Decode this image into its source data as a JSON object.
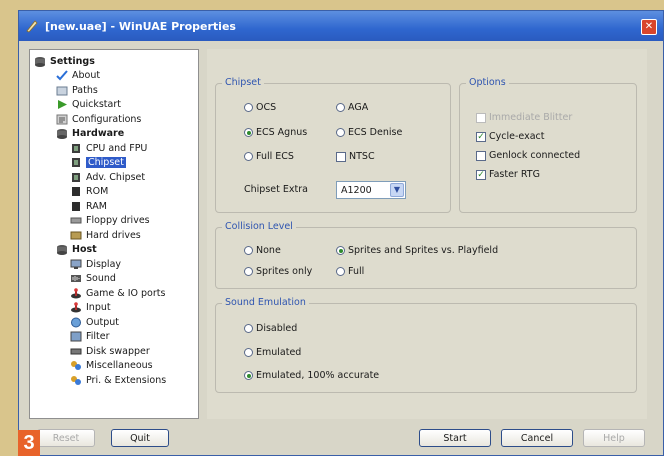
{
  "window": {
    "title": "[new.uae] - WinUAE Properties",
    "close_glyph": "✕"
  },
  "tree": {
    "settings_label": "Settings",
    "about": "About",
    "paths": "Paths",
    "quickstart": "Quickstart",
    "configurations": "Configurations",
    "hardware_label": "Hardware",
    "hardware_items": [
      "CPU and FPU",
      "Chipset",
      "Adv. Chipset",
      "ROM",
      "RAM",
      "Floppy drives",
      "Hard drives"
    ],
    "host_label": "Host",
    "host_items": [
      "Display",
      "Sound",
      "Game & IO ports",
      "Input",
      "Output",
      "Filter",
      "Disk swapper",
      "Miscellaneous",
      "Pri. & Extensions"
    ],
    "selected": "Chipset"
  },
  "chipset": {
    "legend": "Chipset",
    "ocs": "OCS",
    "aga": "AGA",
    "ecs_agnus": "ECS Agnus",
    "ecs_denise": "ECS Denise",
    "full_ecs": "Full ECS",
    "ntsc": "NTSC",
    "extra_label": "Chipset Extra",
    "extra_value": "A1200"
  },
  "options": {
    "legend": "Options",
    "immediate_blitter": "Immediate Blitter",
    "cycle_exact": "Cycle-exact",
    "genlock": "Genlock connected",
    "faster_rtg": "Faster RTG"
  },
  "collision": {
    "legend": "Collision Level",
    "none": "None",
    "sprites_playfield": "Sprites and Sprites vs. Playfield",
    "sprites_only": "Sprites only",
    "full": "Full"
  },
  "sound": {
    "legend": "Sound Emulation",
    "disabled": "Disabled",
    "emulated": "Emulated",
    "accurate": "Emulated, 100% accurate"
  },
  "buttons": {
    "reset": "Reset",
    "quit": "Quit",
    "start": "Start",
    "cancel": "Cancel",
    "help": "Help"
  },
  "badge": "3",
  "colors": {
    "title_bar": "#2f67cf",
    "selection": "#2f5bc9",
    "legend": "#2f55b0",
    "badge": "#e8632a"
  }
}
